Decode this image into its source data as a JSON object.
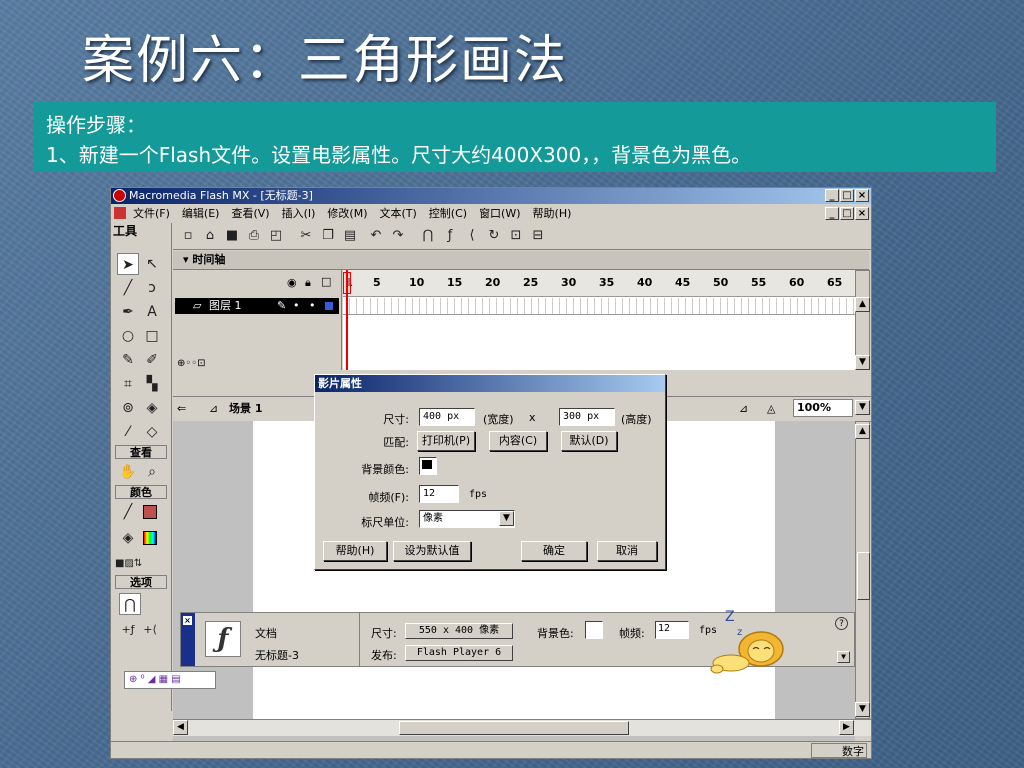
{
  "slide": {
    "title": "案例六：三角形画法",
    "step_heading": "操作步骤：",
    "step_1": "1、新建一个Flash文件。设置电影属性。尺寸大约400X300，，背景色为黑色。"
  },
  "app": {
    "window_title": "Macromedia Flash MX - [无标题-3]",
    "menu": [
      "文件(F)",
      "编辑(E)",
      "查看(V)",
      "插入(I)",
      "修改(M)",
      "文本(T)",
      "控制(C)",
      "窗口(W)",
      "帮助(H)"
    ],
    "window_buttons": {
      "minimize": "_",
      "restore": "□",
      "close": "×"
    }
  },
  "tools": {
    "header": "工具",
    "view_label": "查看",
    "colors_label": "颜色",
    "options_label": "选项",
    "stroke_color": "#c0504d",
    "icons": [
      "arrow-icon",
      "subselect-icon",
      "line-icon",
      "lasso-icon",
      "pen-icon",
      "text-icon",
      "oval-icon",
      "rectangle-icon",
      "pencil-icon",
      "brush-icon",
      "free-transform-icon",
      "fill-transform-icon",
      "ink-bottle-icon",
      "paint-bucket-icon",
      "eyedropper-icon",
      "eraser-icon",
      "hand-icon",
      "zoom-icon"
    ]
  },
  "timeline": {
    "header": "时间轴",
    "layer_name": "图层 1",
    "frame_numbers": [
      "1",
      "5",
      "10",
      "15",
      "20",
      "25",
      "30",
      "35",
      "40",
      "45",
      "50",
      "55",
      "60",
      "65"
    ]
  },
  "scene": {
    "name": "场景 1",
    "zoom": "100%"
  },
  "dialog": {
    "title": "影片属性",
    "size_label": "尺寸:",
    "width_value": "400 px",
    "width_label": "(宽度)",
    "x_sep": "x",
    "height_value": "300 px",
    "height_label": "(高度)",
    "match_label": "匹配:",
    "printer_button": "打印机(P)",
    "contents_button": "内容(C)",
    "default_button": "默认(D)",
    "bg_label": "背景颜色:",
    "bg_color": "#000000",
    "fps_label": "帧频(F):",
    "fps_value": "12",
    "fps_unit": "fps",
    "ruler_label": "标尺单位:",
    "ruler_value": "像素",
    "help_button": "帮助(H)",
    "make_default_button": "设为默认值",
    "ok_button": "确定",
    "cancel_button": "取消"
  },
  "properties": {
    "doc_label": "文档",
    "doc_name": "无标题-3",
    "size_label": "尺寸:",
    "size_value": "550 x 400 像素",
    "bg_label": "背景色:",
    "fps_label": "帧频:",
    "fps_value": "12",
    "fps_unit": "fps",
    "publish_label": "发布:",
    "publish_value": "Flash Player 6",
    "help_icon": "?",
    "sleep_z1": "Z",
    "sleep_z2": "z"
  },
  "status": {
    "num": "数字"
  }
}
